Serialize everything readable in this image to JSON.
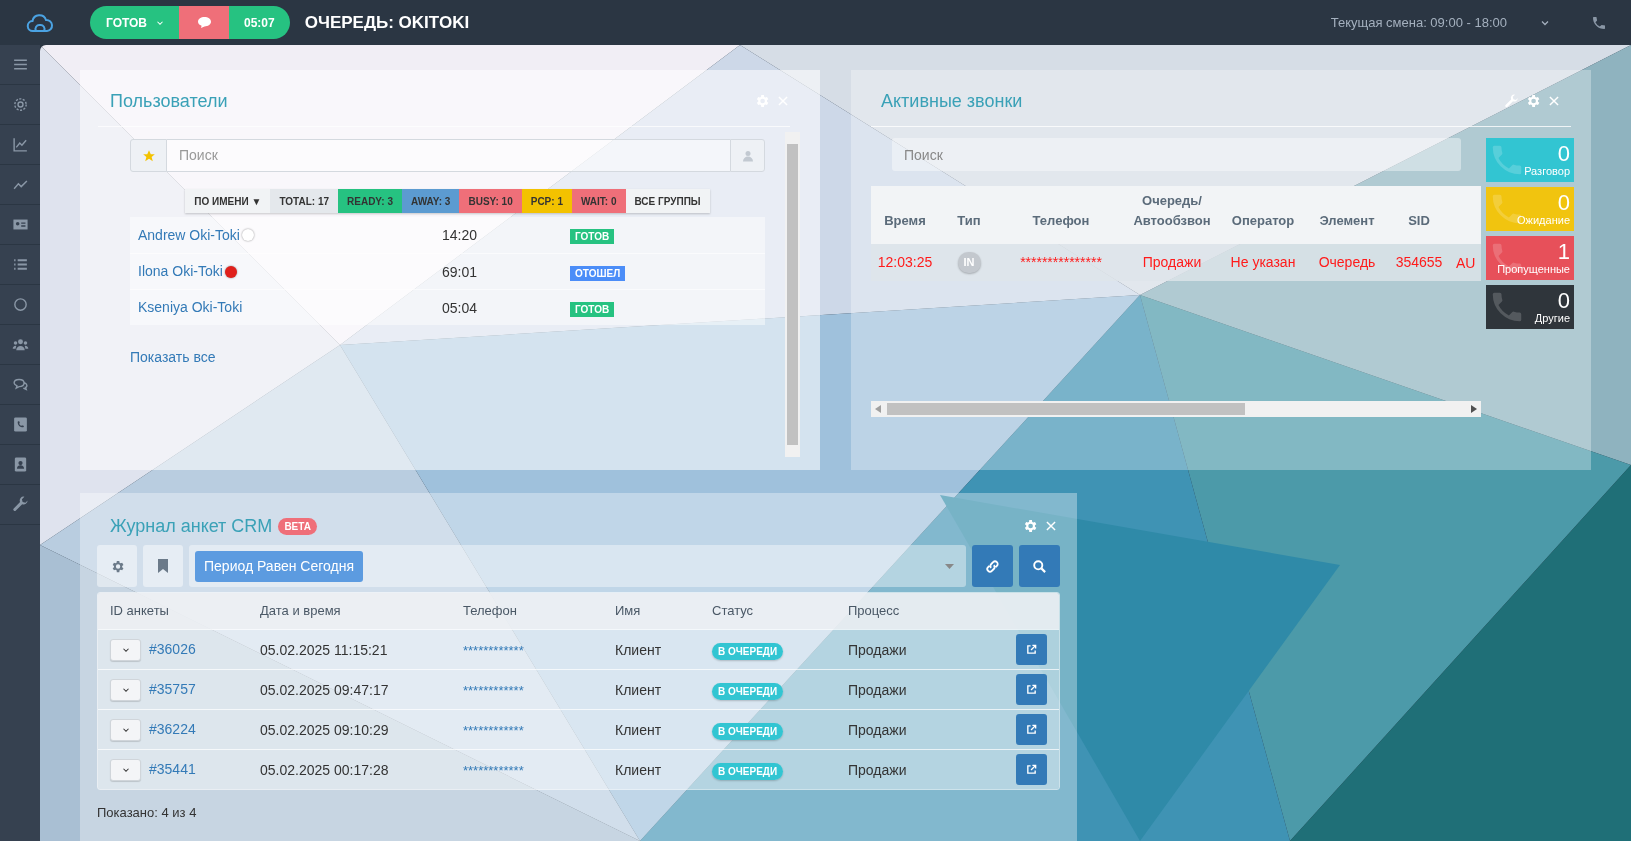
{
  "topbar": {
    "status_button": "ГОТОВ",
    "timer": "05:07",
    "queue_title": "ОЧЕРЕДЬ: OKITOKI",
    "shift": "Текущая смена: 09:00 - 18:00"
  },
  "users_panel": {
    "title": "Пользователи",
    "search": {
      "placeholder": "Поиск"
    },
    "filters": [
      {
        "label": "ПО ИМЕНИ ▼",
        "color": "#f1f3f5"
      },
      {
        "label": "TOTAL: 17",
        "color": "#e4e8ec"
      },
      {
        "label": "READY: 3",
        "color": "#26c281"
      },
      {
        "label": "AWAY: 3",
        "color": "#5c9bd1"
      },
      {
        "label": "BUSY: 10",
        "color": "#ef6f79"
      },
      {
        "label": "PCP: 1",
        "color": "#f3c200"
      },
      {
        "label": "WAIT: 0",
        "color": "#ef6f79"
      },
      {
        "label": "ВСЕ ГРУППЫ",
        "color": "#f1f3f5"
      }
    ],
    "rows": [
      {
        "name": "Andrew Oki-Toki",
        "presence": {
          "color": "#ffffff"
        },
        "time": "14:20",
        "status": {
          "label": "ГОТОВ",
          "color": "#26c281"
        }
      },
      {
        "name": "Ilona Oki-Toki",
        "presence": {
          "color": "#e0201b"
        },
        "time": "69:01",
        "status": {
          "label": "ОТОШЕЛ",
          "color": "#4b8df8"
        }
      },
      {
        "name": "Kseniya Oki-Toki",
        "time": "05:04",
        "status": {
          "label": "ГОТОВ",
          "color": "#26c281"
        }
      }
    ],
    "show_all": "Показать все"
  },
  "calls_panel": {
    "title": "Активные звонки",
    "search": {
      "placeholder": "Поиск"
    },
    "columns": [
      "Время",
      "Тип",
      "Телефон",
      "Очередь/ Автообзвон",
      "Оператор",
      "Элемент",
      "SID"
    ],
    "rows": [
      {
        "time": "12:03:25",
        "type": "IN",
        "phone": "***************",
        "queue": "Продажи",
        "operator": "Не указан",
        "element": "Очередь",
        "sid": "354655",
        "column_8": "AU"
      }
    ],
    "counters": [
      {
        "value": "0",
        "label": "Разговор",
        "color": "#32c5d2"
      },
      {
        "value": "0",
        "label": "Ожидание",
        "color": "#f1c40f"
      },
      {
        "value": "1",
        "label": "Пропущенные",
        "color": "#e7505a"
      },
      {
        "value": "0",
        "label": "Другие",
        "color": "#2f353b"
      }
    ]
  },
  "crm_panel": {
    "title": "Журнал анкет CRM",
    "badge": "BETA",
    "filter_chip": "Период Равен Сегодня",
    "columns": [
      "ID анкеты",
      "Дата и время",
      "Телефон",
      "Имя",
      "Статус",
      "Процесс"
    ],
    "rows": [
      {
        "id": "#36026",
        "datetime": "05.02.2025 11:15:21",
        "phone": "************",
        "name": "Клиент",
        "status": "В ОЧЕРЕДИ",
        "process": "Продажи"
      },
      {
        "id": "#35757",
        "datetime": "05.02.2025 09:47:17",
        "phone": "************",
        "name": "Клиент",
        "status": "В ОЧЕРЕДИ",
        "process": "Продажи"
      },
      {
        "id": "#36224",
        "datetime": "05.02.2025 09:10:29",
        "phone": "************",
        "name": "Клиент",
        "status": "В ОЧЕРЕДИ",
        "process": "Продажи"
      },
      {
        "id": "#35441",
        "datetime": "05.02.2025 00:17:28",
        "phone": "************",
        "name": "Клиент",
        "status": "В ОЧЕРЕДИ",
        "process": "Продажи"
      }
    ],
    "footer": "Показано: 4 из 4"
  }
}
